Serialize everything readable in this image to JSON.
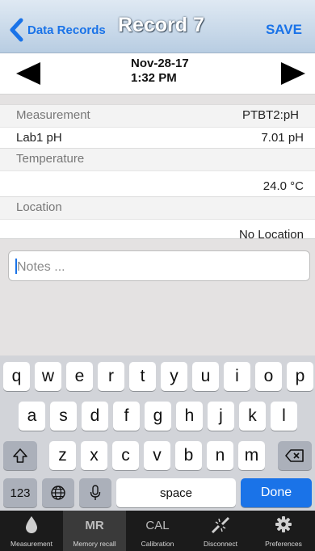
{
  "nav": {
    "back_label": "Data Records",
    "title": "Record 7",
    "save_label": "SAVE"
  },
  "date": {
    "line1": "Nov-28-17",
    "line2": "1:32 PM"
  },
  "measurement": {
    "label": "Measurement",
    "probe": "PTBT2:pH",
    "name": "Lab1 pH",
    "value": "7.01 pH"
  },
  "temperature": {
    "label": "Temperature",
    "value": "24.0 °C"
  },
  "location": {
    "label": "Location",
    "value": "No Location"
  },
  "notes": {
    "placeholder": "Notes ..."
  },
  "keyboard": {
    "row1": [
      "q",
      "w",
      "e",
      "r",
      "t",
      "y",
      "u",
      "i",
      "o",
      "p"
    ],
    "row2": [
      "a",
      "s",
      "d",
      "f",
      "g",
      "h",
      "j",
      "k",
      "l"
    ],
    "row3": [
      "z",
      "x",
      "c",
      "v",
      "b",
      "n",
      "m"
    ],
    "numbers_label": "123",
    "space_label": "space",
    "done_label": "Done"
  },
  "tabs": [
    {
      "icon": "droplet-icon",
      "label": "Measurement"
    },
    {
      "icon_text": "MR",
      "label": "Memory recall"
    },
    {
      "icon_text": "CAL",
      "label": "Calibration"
    },
    {
      "icon": "disconnect-icon",
      "label": "Disconnect"
    },
    {
      "icon": "gear-icon",
      "label": "Preferences"
    }
  ],
  "colors": {
    "accent": "#1a73e8",
    "tabbar": "#1b1b1b",
    "keyboard": "#d2d4d9"
  }
}
